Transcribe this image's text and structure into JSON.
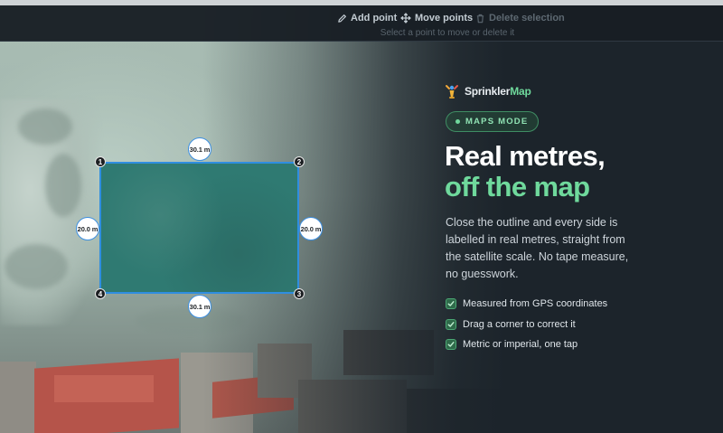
{
  "toolbar": {
    "add_point": "Add point",
    "move_points": "Move points",
    "delete_selection": "Delete selection",
    "hint": "Select a point to move or delete it",
    "icons": {
      "add_point": "pencil-icon",
      "move_points": "move-arrows-icon",
      "delete_selection": "trash-icon"
    }
  },
  "map": {
    "vertices": [
      "1",
      "2",
      "3",
      "4"
    ],
    "edges": {
      "top": "30.1 m",
      "right": "20.0 m",
      "bottom": "30.1 m",
      "left": "20.0 m"
    },
    "colors": {
      "outline": "#2f8ee0",
      "fill": "#2f7a72"
    }
  },
  "panel": {
    "brand_prefix": "Sprinkler",
    "brand_suffix": "Map",
    "badge": "MAPS MODE",
    "headline_line1": "Real metres,",
    "headline_line2": "off the map",
    "body": "Close the outline and every side is labelled in real metres, straight from the satellite scale. No tape measure, no guesswork.",
    "features": [
      "Measured from GPS coordinates",
      "Drag a corner to correct it",
      "Metric or imperial, one tap"
    ],
    "colors": {
      "accent": "#6fd99c",
      "background": "#1c242b"
    }
  }
}
